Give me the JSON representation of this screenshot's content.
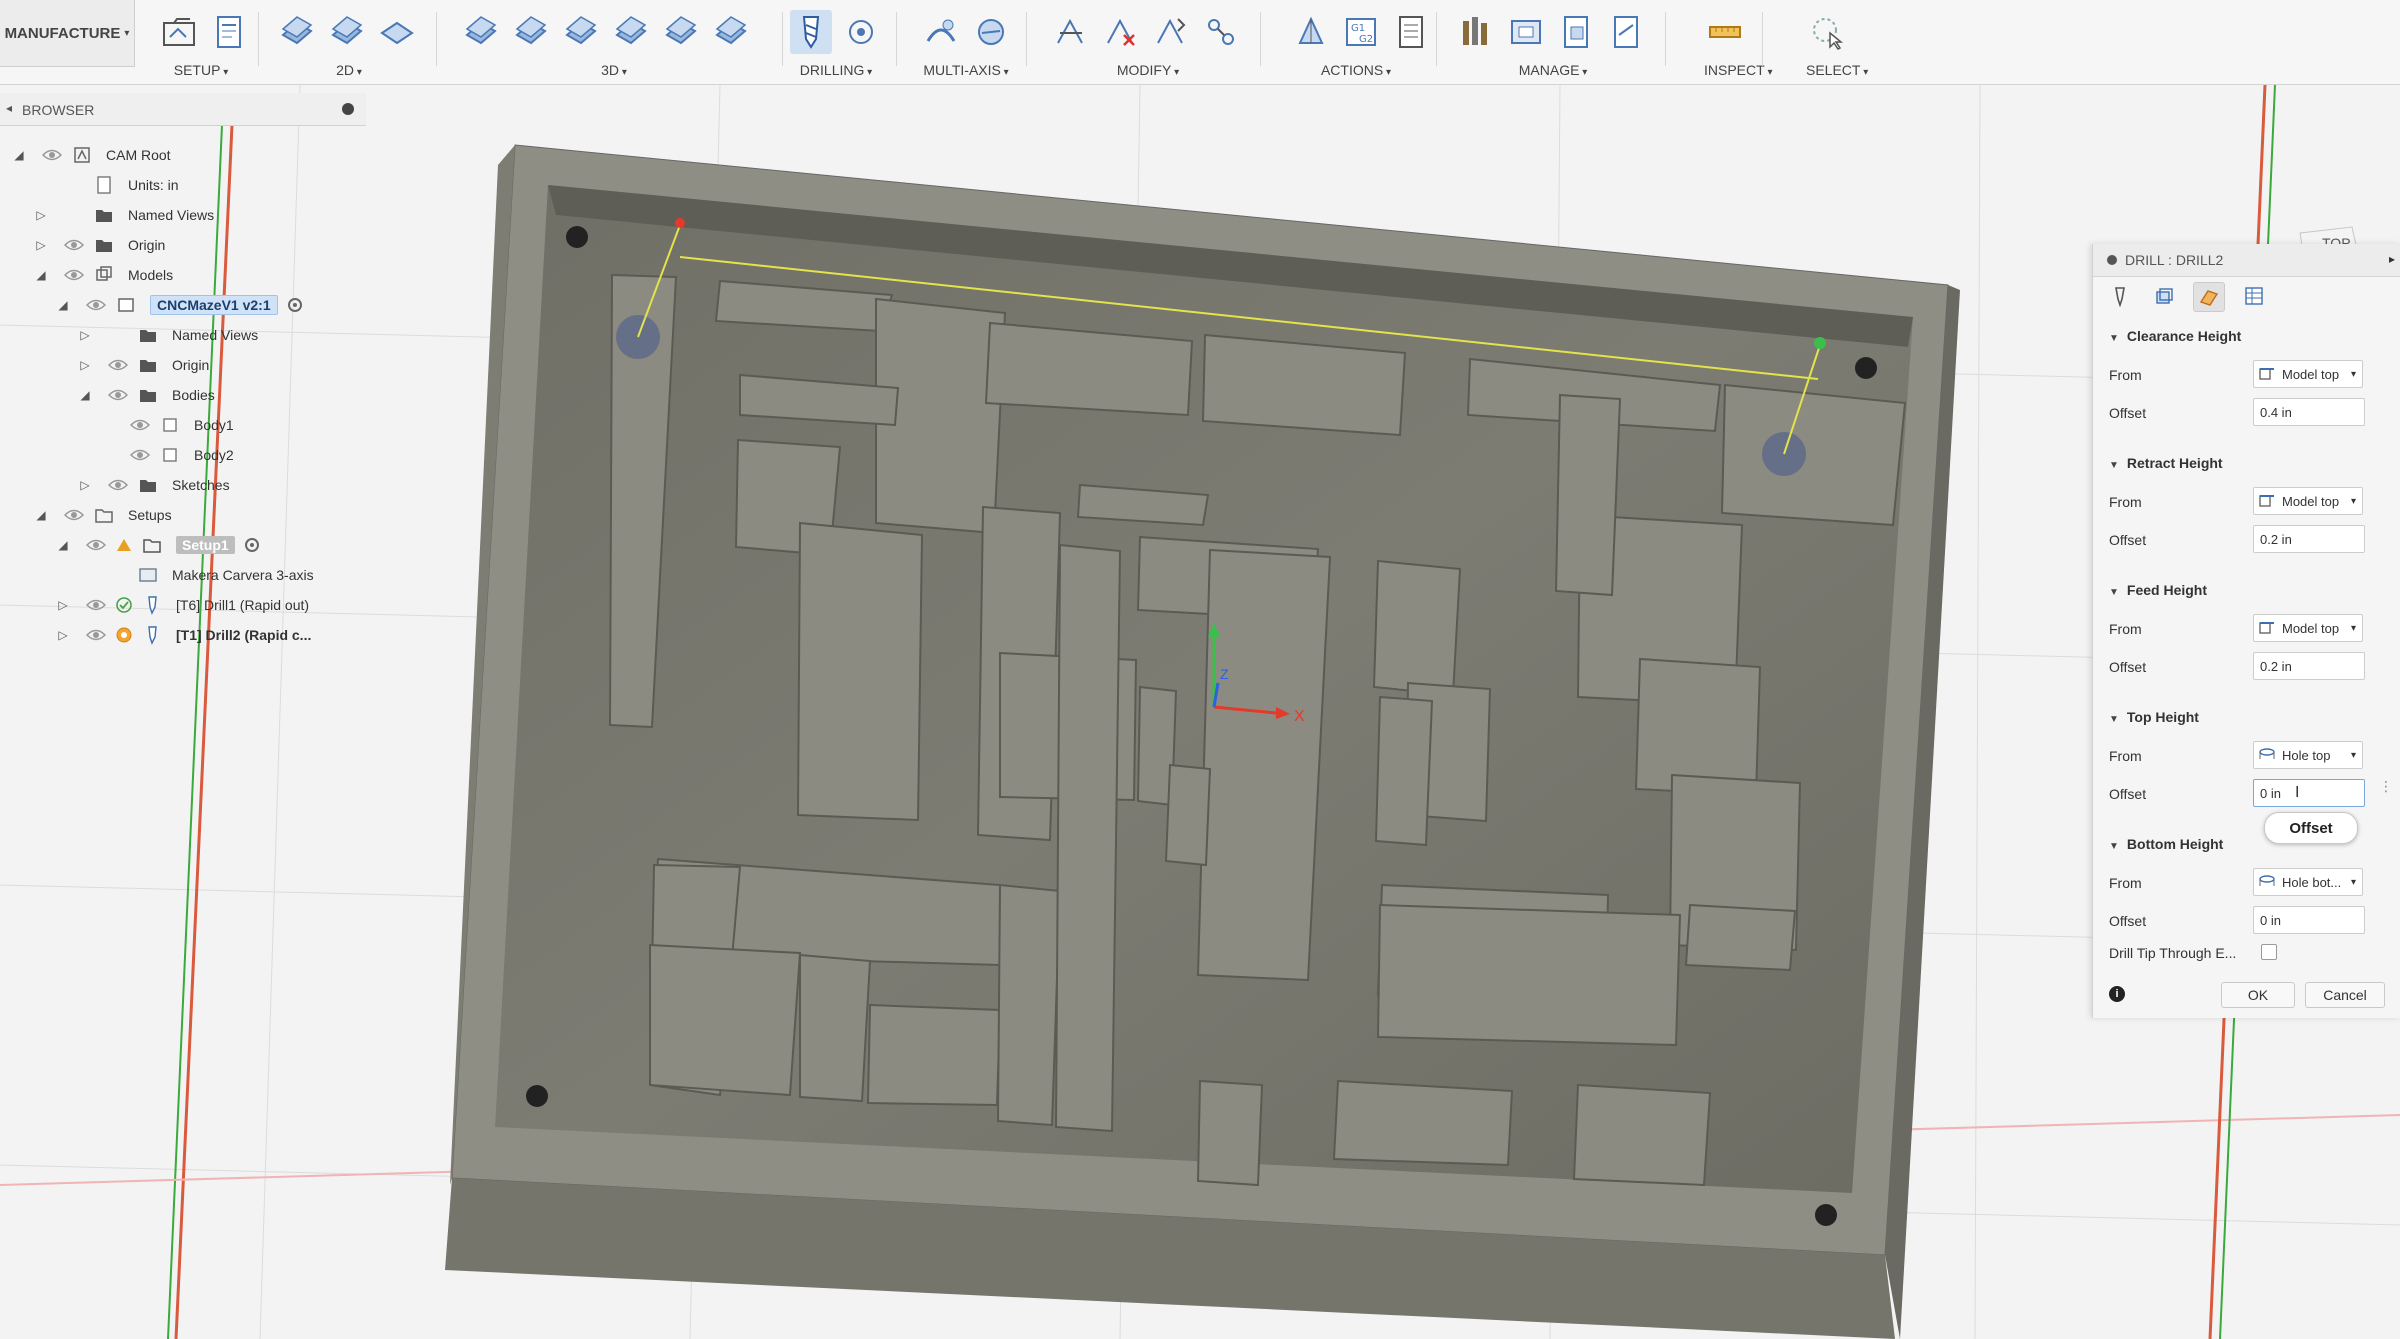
{
  "toolbar": {
    "workspace": "MANUFACTURE",
    "groups": [
      {
        "label": "SETUP",
        "icons": [
          "setup-folder-icon",
          "setup-sheet-icon"
        ]
      },
      {
        "label": "2D",
        "icons": [
          "2d-adaptive-icon",
          "2d-pocket-icon",
          "face-icon"
        ]
      },
      {
        "label": "3D",
        "icons": [
          "3d-adaptive-icon",
          "3d-pocket-icon",
          "steep-shallow-icon",
          "contour-icon",
          "scallop-icon",
          "parallel-icon"
        ]
      },
      {
        "label": "DRILLING",
        "icons": [
          "drill-icon",
          "hole-recognition-icon"
        ]
      },
      {
        "label": "MULTI-AXIS",
        "icons": [
          "swarf-icon",
          "multi-axis-contour-icon"
        ]
      },
      {
        "label": "MODIFY",
        "icons": [
          "toolpath-trim-icon",
          "delete-toolpath-icon",
          "move-toolpath-icon",
          "pattern-icon"
        ]
      },
      {
        "label": "ACTIONS",
        "icons": [
          "simulate-icon",
          "post-process-icon",
          "setup-sheet-doc-icon"
        ]
      },
      {
        "label": "MANAGE",
        "icons": [
          "tool-library-icon",
          "machine-library-icon",
          "template-library-icon",
          "post-library-icon"
        ]
      },
      {
        "label": "INSPECT",
        "icons": [
          "measure-icon"
        ]
      },
      {
        "label": "SELECT",
        "icons": [
          "select-icon"
        ]
      }
    ]
  },
  "browser": {
    "title": "BROWSER",
    "rows": [
      {
        "label": "CAM Root"
      },
      {
        "label": "Units: in"
      },
      {
        "label": "Named Views"
      },
      {
        "label": "Origin"
      },
      {
        "label": "Models"
      },
      {
        "label": "CNCMazeV1 v2:1"
      },
      {
        "label": "Named Views"
      },
      {
        "label": "Origin"
      },
      {
        "label": "Bodies"
      },
      {
        "label": "Body1"
      },
      {
        "label": "Body2"
      },
      {
        "label": "Sketches"
      },
      {
        "label": "Setups"
      },
      {
        "label": "Setup1"
      },
      {
        "label": "Makera Carvera 3-axis"
      },
      {
        "label": "[T6] Drill1 (Rapid out)"
      },
      {
        "label": "[T1] Drill2 (Rapid c..."
      }
    ]
  },
  "panel": {
    "title": "DRILL : DRILL2",
    "sections": [
      {
        "title": "Clearance Height",
        "from_label": "From",
        "from_value": "Model top",
        "offset_label": "Offset",
        "offset_value": "0.4 in"
      },
      {
        "title": "Retract Height",
        "from_label": "From",
        "from_value": "Model top",
        "offset_label": "Offset",
        "offset_value": "0.2 in"
      },
      {
        "title": "Feed Height",
        "from_label": "From",
        "from_value": "Model top",
        "offset_label": "Offset",
        "offset_value": "0.2 in"
      },
      {
        "title": "Top Height",
        "from_label": "From",
        "from_value": "Hole top",
        "offset_label": "Offset",
        "offset_value": "0 in"
      },
      {
        "title": "Bottom Height",
        "from_label": "From",
        "from_value": "Hole bot...",
        "offset_label": "Offset",
        "offset_value": "0 in"
      }
    ],
    "drill_tip_label": "Drill Tip Through E...",
    "ok_label": "OK",
    "cancel_label": "Cancel",
    "tooltip": "Offset"
  },
  "viewport": {
    "viewcube_face": "TOP",
    "axis_x_label": "X",
    "axis_z_label": "Z"
  }
}
